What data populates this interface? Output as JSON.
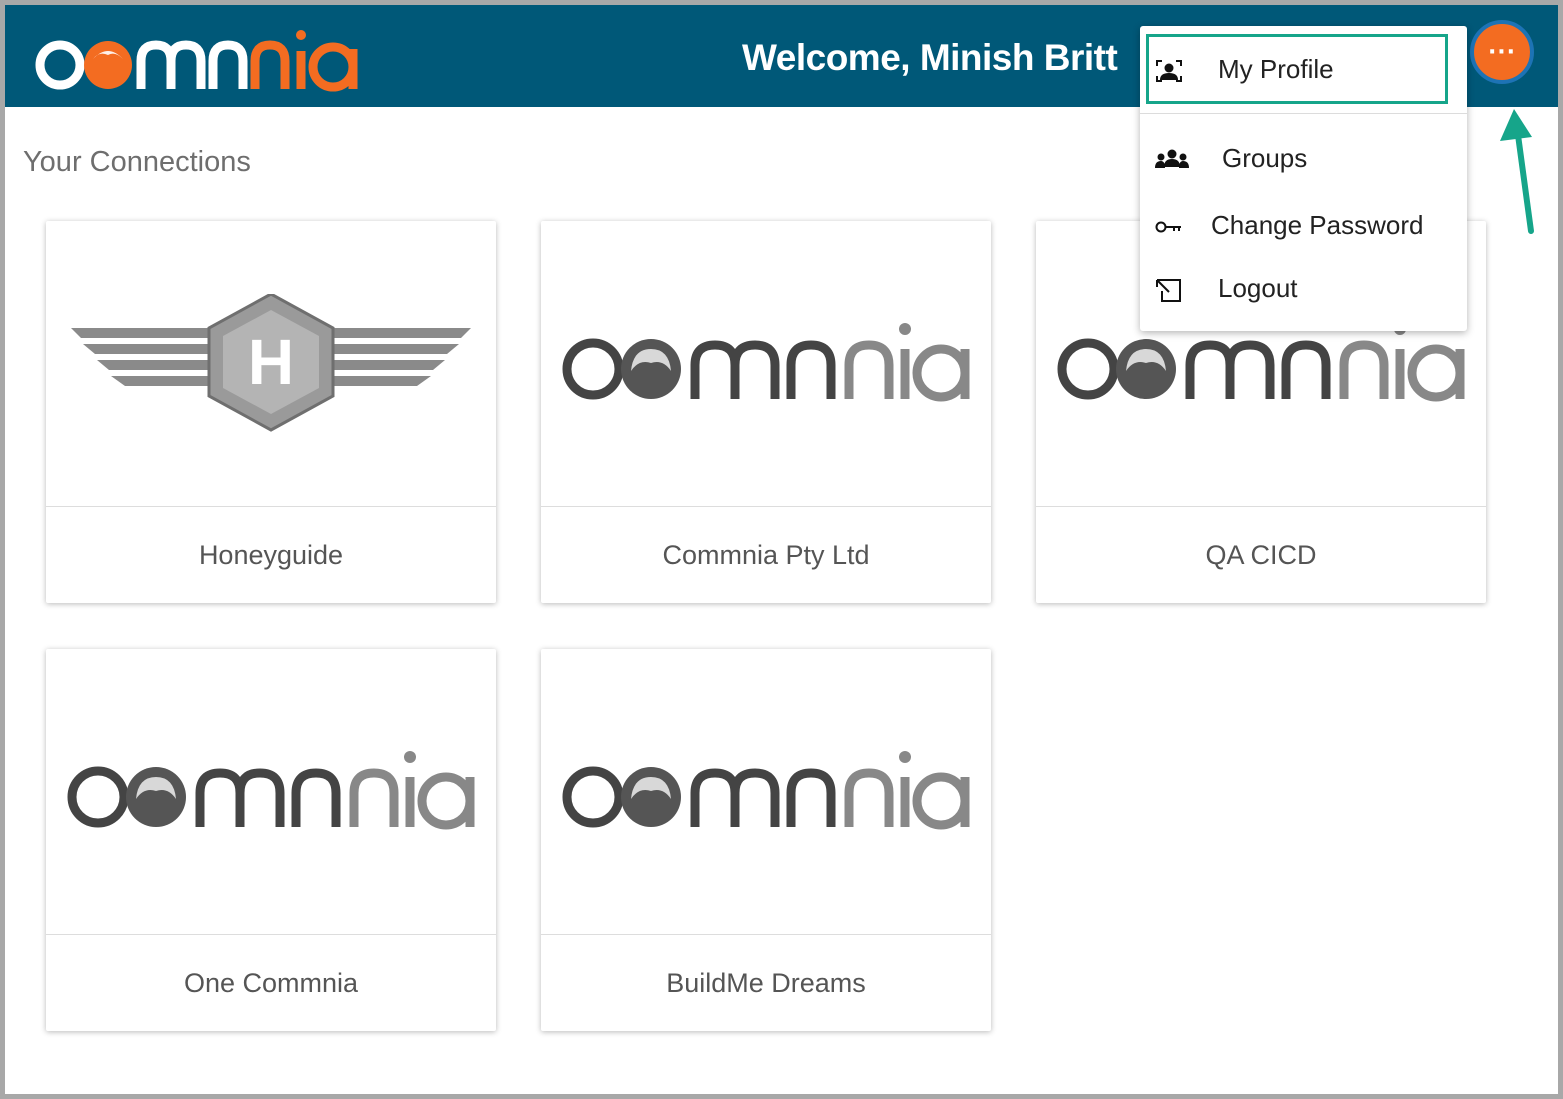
{
  "header": {
    "welcome_text": "Welcome, Minish Britt",
    "menu_button_label": "···",
    "logo": {
      "text": "commnia",
      "colors": {
        "white": "#ffffff",
        "orange": "#f36c21"
      }
    }
  },
  "colors": {
    "topbar": "#005878",
    "accent_orange": "#f36c21",
    "menu_ring": "#1d73b5",
    "highlight_teal": "#16a58a"
  },
  "main": {
    "section_title": "Your Connections",
    "connections": [
      {
        "name": "Honeyguide",
        "logo": "honeyguide-logo"
      },
      {
        "name": "Commnia Pty Ltd",
        "logo": "commnia-logo"
      },
      {
        "name": "QA CICD",
        "logo": "commnia-logo"
      },
      {
        "name": "One Commnia",
        "logo": "commnia-logo"
      },
      {
        "name": "BuildMe Dreams",
        "logo": "commnia-logo"
      }
    ]
  },
  "user_menu": {
    "items": [
      {
        "label": "My Profile",
        "icon": "profile-icon",
        "highlighted": true
      },
      {
        "label": "Groups",
        "icon": "groups-icon"
      },
      {
        "label": "Change Password",
        "icon": "key-icon"
      },
      {
        "label": "Logout",
        "icon": "logout-icon"
      }
    ]
  }
}
